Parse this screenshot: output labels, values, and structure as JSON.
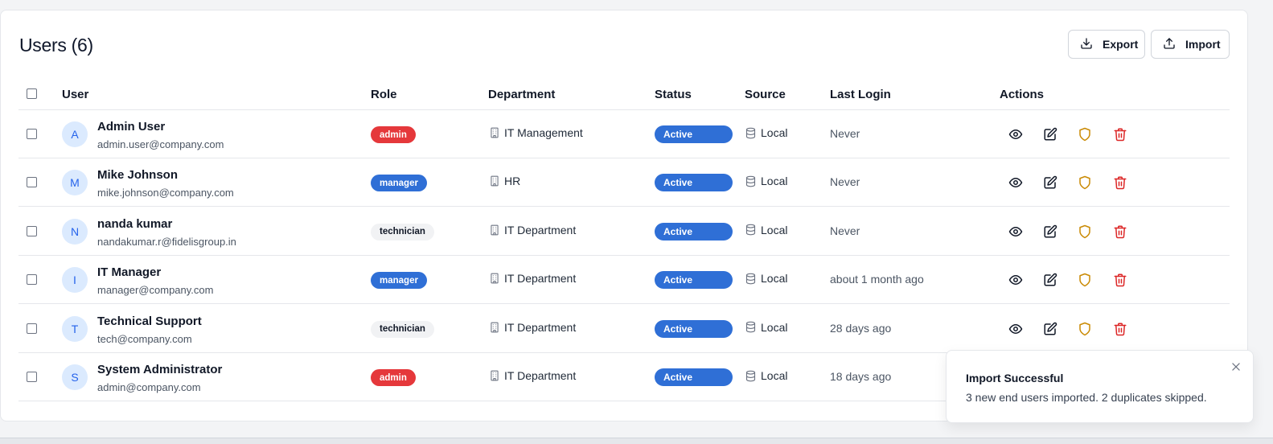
{
  "header": {
    "title": "Users (6)",
    "export_label": "Export",
    "import_label": "Import"
  },
  "columns": [
    "User",
    "Role",
    "Department",
    "Status",
    "Source",
    "Last Login",
    "Actions"
  ],
  "users": [
    {
      "initial": "A",
      "name": "Admin User",
      "email": "admin.user@company.com",
      "role": "admin",
      "department": "IT Management",
      "status": "Active",
      "source": "Local",
      "last_login": "Never"
    },
    {
      "initial": "M",
      "name": "Mike Johnson",
      "email": "mike.johnson@company.com",
      "role": "manager",
      "department": "HR",
      "status": "Active",
      "source": "Local",
      "last_login": "Never"
    },
    {
      "initial": "N",
      "name": "nanda kumar",
      "email": "nandakumar.r@fidelisgroup.in",
      "role": "technician",
      "department": "IT Department",
      "status": "Active",
      "source": "Local",
      "last_login": "Never"
    },
    {
      "initial": "I",
      "name": "IT Manager",
      "email": "manager@company.com",
      "role": "manager",
      "department": "IT Department",
      "status": "Active",
      "source": "Local",
      "last_login": "about 1 month ago"
    },
    {
      "initial": "T",
      "name": "Technical Support",
      "email": "tech@company.com",
      "role": "technician",
      "department": "IT Department",
      "status": "Active",
      "source": "Local",
      "last_login": "28 days ago"
    },
    {
      "initial": "S",
      "name": "System Administrator",
      "email": "admin@company.com",
      "role": "admin",
      "department": "IT Department",
      "status": "Active",
      "source": "Local",
      "last_login": "18 days ago"
    }
  ],
  "row_actions": [
    "eye-icon",
    "edit-icon",
    "shield-icon",
    "trash-icon"
  ],
  "toast": {
    "title": "Import Successful",
    "message": "3 new end users imported. 2 duplicates skipped."
  },
  "colors": {
    "admin": "#e5383b",
    "manager": "#2f6fd6",
    "technician": "#f1f2f4",
    "status_active": "#2f6fd6",
    "shield": "#ca8a04",
    "trash": "#dc2626"
  }
}
